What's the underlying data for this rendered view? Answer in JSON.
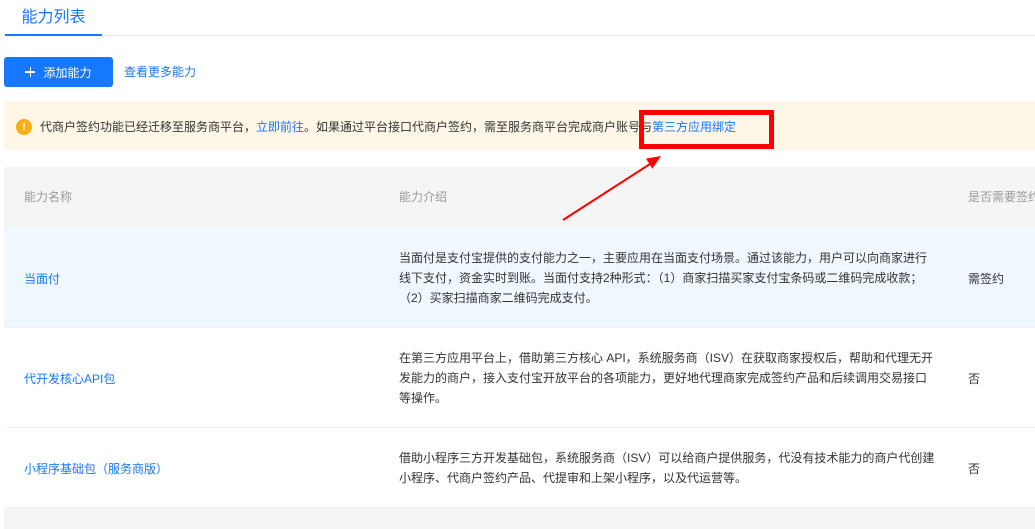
{
  "tabs": [
    {
      "label": "能力列表"
    }
  ],
  "toolbar": {
    "add_button_icon": "plus-icon",
    "add_button_label": "添加能力",
    "more_link_label": "查看更多能力"
  },
  "alert": {
    "icon": "warning-circle-icon",
    "text_before_link": "代商户签约功能已经迁移至服务商平台，",
    "go_link_label": "立即前往",
    "text_after_link": "。如果通过平台接口代商户签约，需至服务商平台完成商户账号与",
    "binding_link_label": "第三方应用绑定"
  },
  "table": {
    "columns": [
      "能力名称",
      "能力介绍",
      "是否需要签约"
    ],
    "rows": [
      {
        "name": "当面付",
        "description_lines": [
          "当面付是支付宝提供的支付能力之一，主要应用在当面支付场景。通过该能力，用户可以向商家进行",
          "线下支付，资金实时到账。当面付支持2种形式：（1）商家扫描买家支付宝条码或二维码完成收款；",
          "（2）买家扫描商家二维码完成支付。"
        ],
        "signing": "需签约"
      },
      {
        "name": "代开发核心API包",
        "description_lines": [
          "在第三方应用平台上，借助第三方核心 API，系统服务商（ISV）在获取商家授权后，帮助和代理无开",
          "发能力的商户，接入支付宝开放平台的各项能力，更好地代理商家完成签约产品和后续调用交易接口",
          "等操作。"
        ],
        "signing": "否"
      },
      {
        "name": "小程序基础包（服务商版）",
        "description_lines": [
          "借助小程序三方开发基础包，系统服务商（ISV）可以给商户提供服务，代没有技术能力的商户代创建",
          "小程序、代商户签约产品、代提审和上架小程序，以及代运营等。"
        ],
        "signing": "否"
      }
    ]
  },
  "colors": {
    "accent": "#1677ff",
    "warning": "#faad14",
    "alert_background": "#fef7e7",
    "header_background": "#f5f5f5",
    "highlighted_row_background": "#f0f7ff",
    "annotation": "#ff0000"
  }
}
